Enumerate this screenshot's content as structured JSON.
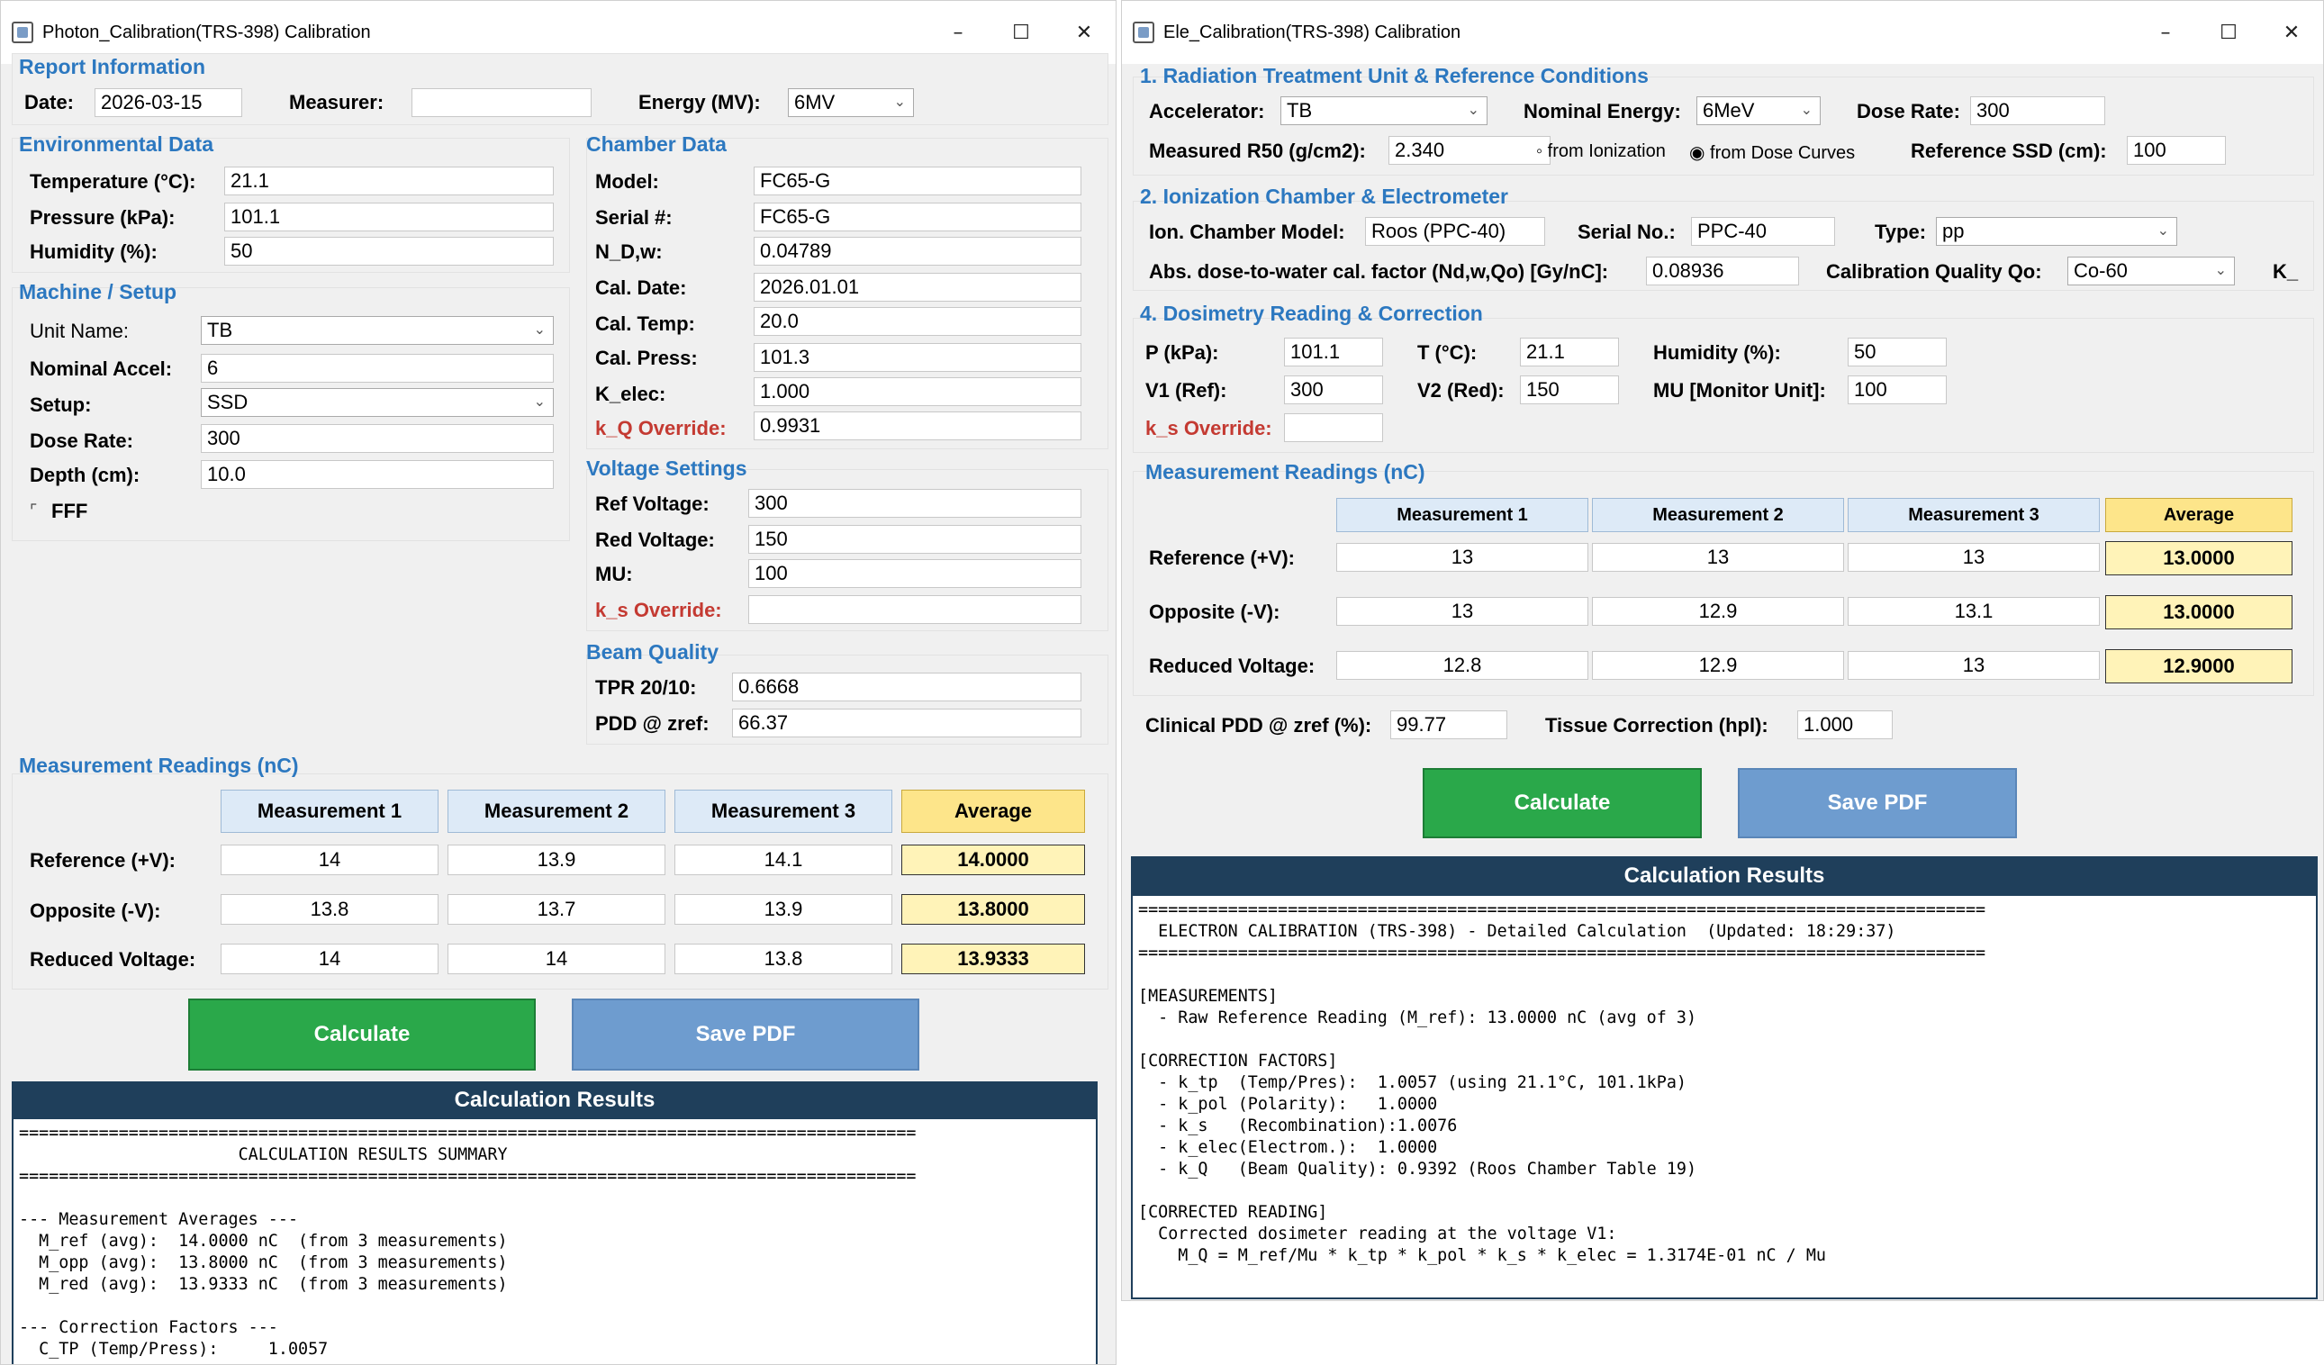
{
  "window1": {
    "title": "Photon_Calibration(TRS-398) Calibration",
    "report": {
      "heading": "Report Information",
      "date_label": "Date:",
      "date": "2026-03-15",
      "measurer_label": "Measurer:",
      "measurer": "",
      "energy_label": "Energy (MV):",
      "energy": "6MV"
    },
    "env": {
      "heading": "Environmental Data",
      "temp_label": "Temperature (°C):",
      "temp": "21.1",
      "press_label": "Pressure (kPa):",
      "press": "101.1",
      "hum_label": "Humidity (%):",
      "hum": "50"
    },
    "machine": {
      "heading": "Machine / Setup",
      "unit_label": "Unit Name:",
      "unit": "TB",
      "accel_label": "Nominal Accel:",
      "accel": "6",
      "setup_label": "Setup:",
      "setup": "SSD",
      "dose_label": "Dose Rate:",
      "dose": "300",
      "depth_label": "Depth (cm):",
      "depth": "10.0",
      "fff_label": "FFF"
    },
    "chamber": {
      "heading": "Chamber Data",
      "model_label": "Model:",
      "model": "FC65-G",
      "serial_label": "Serial #:",
      "serial": "FC65-G",
      "ndw_label": "N_D,w:",
      "ndw": "0.04789",
      "caldate_label": "Cal. Date:",
      "caldate": "2026.01.01",
      "caltemp_label": "Cal. Temp:",
      "caltemp": "20.0",
      "calpress_label": "Cal. Press:",
      "calpress": "101.3",
      "kelec_label": "K_elec:",
      "kelec": "1.000",
      "kq_label": "k_Q Override:",
      "kq": "0.9931"
    },
    "voltage": {
      "heading": "Voltage Settings",
      "ref_label": "Ref Voltage:",
      "ref": "300",
      "red_label": "Red Voltage:",
      "red": "150",
      "mu_label": "MU:",
      "mu": "100",
      "ks_label": "k_s Override:",
      "ks": ""
    },
    "beam": {
      "heading": "Beam Quality",
      "tpr_label": "TPR 20/10:",
      "tpr": "0.6668",
      "pdd_label": "PDD @ zref:",
      "pdd": "66.37"
    },
    "meas": {
      "heading": "Measurement Readings (nC)",
      "cols": [
        "Measurement 1",
        "Measurement 2",
        "Measurement 3",
        "Average"
      ],
      "rows": [
        {
          "label": "Reference (+V):",
          "v": [
            "14",
            "13.9",
            "14.1",
            "14.0000"
          ]
        },
        {
          "label": "Opposite (-V):",
          "v": [
            "13.8",
            "13.7",
            "13.9",
            "13.8000"
          ]
        },
        {
          "label": "Reduced Voltage:",
          "v": [
            "14",
            "14",
            "13.8",
            "13.9333"
          ]
        }
      ]
    },
    "calc_label": "Calculate",
    "pdf_label": "Save PDF",
    "results_heading": "Calculation Results",
    "results": [
      "==========================================================================================",
      "                      CALCULATION RESULTS SUMMARY",
      "==========================================================================================",
      "",
      "--- Measurement Averages ---",
      "  M_ref (avg):  14.0000 nC  (from 3 measurements)",
      "  M_opp (avg):  13.8000 nC  (from 3 measurements)",
      "  M_red (avg):  13.9333 nC  (from 3 measurements)",
      "",
      "--- Correction Factors ---",
      "  C_TP (Temp/Press):     1.0057"
    ]
  },
  "window2": {
    "title": "Ele_Calibration(TRS-398) Calibration",
    "unit": {
      "heading": "1. Radiation Treatment Unit & Reference Conditions",
      "acc_label": "Accelerator:",
      "acc": "TB",
      "energy_label": "Nominal Energy:",
      "energy": "6MeV",
      "dose_label": "Dose Rate:",
      "dose": "300",
      "r50_label": "Measured R50 (g/cm2):",
      "r50": "2.340",
      "opt1": "from Ionization",
      "opt2": "from Dose Curves",
      "ssd_label": "Reference SSD (cm):",
      "ssd": "100"
    },
    "chamber": {
      "heading": "2. Ionization Chamber & Electrometer",
      "model_label": "Ion. Chamber Model:",
      "model": "Roos (PPC-40)",
      "serial_label": "Serial No.:",
      "serial": "PPC-40",
      "type_label": "Type:",
      "type": "pp",
      "ndw_label": "Abs. dose-to-water cal. factor (Nd,w,Qo) [Gy/nC]:",
      "ndw": "0.08936",
      "qo_label": "Calibration Quality Qo:",
      "qo": "Co-60",
      "k_label": "K_"
    },
    "dosi": {
      "heading": "4. Dosimetry Reading & Correction",
      "p_label": "P (kPa):",
      "p": "101.1",
      "t_label": "T (°C):",
      "t": "21.1",
      "hum_label": "Humidity (%):",
      "hum": "50",
      "v1_label": "V1 (Ref):",
      "v1": "300",
      "v2_label": "V2 (Red):",
      "v2": "150",
      "mu_label": "MU [Monitor Unit]:",
      "mu": "100",
      "ks_label": "k_s Override:",
      "ks": ""
    },
    "meas": {
      "heading": "Measurement Readings (nC)",
      "cols": [
        "Measurement 1",
        "Measurement 2",
        "Measurement 3",
        "Average"
      ],
      "rows": [
        {
          "label": "Reference (+V):",
          "v": [
            "13",
            "13",
            "13",
            "13.0000"
          ]
        },
        {
          "label": "Opposite (-V):",
          "v": [
            "13",
            "12.9",
            "13.1",
            "13.0000"
          ]
        },
        {
          "label": "Reduced Voltage:",
          "v": [
            "12.8",
            "12.9",
            "13",
            "12.9000"
          ]
        }
      ]
    },
    "pdd_label": "Clinical PDD @ zref (%):",
    "pdd": "99.77",
    "tissue_label": "Tissue Correction (hpl):",
    "tissue": "1.000",
    "calc_label": "Calculate",
    "pdf_label": "Save PDF",
    "results_heading": "Calculation Results",
    "results": [
      "=====================================================================================",
      "  ELECTRON CALIBRATION (TRS-398) - Detailed Calculation  (Updated: 18:29:37)",
      "=====================================================================================",
      "",
      "[MEASUREMENTS]",
      "  - Raw Reference Reading (M_ref): 13.0000 nC (avg of 3)",
      "",
      "[CORRECTION FACTORS]",
      "  - k_tp  (Temp/Pres):  1.0057 (using 21.1°C, 101.1kPa)",
      "  - k_pol (Polarity):   1.0000",
      "  - k_s   (Recombination):1.0076",
      "  - k_elec(Electrom.):  1.0000",
      "  - k_Q   (Beam Quality): 0.9392 (Roos Chamber Table 19)",
      "",
      "[CORRECTED READING]",
      "  Corrected dosimeter reading at the voltage V1:",
      "    M_Q = M_ref/Mu * k_tp * k_pol * k_s * k_elec = 1.3174E-01 nC / Mu"
    ]
  }
}
